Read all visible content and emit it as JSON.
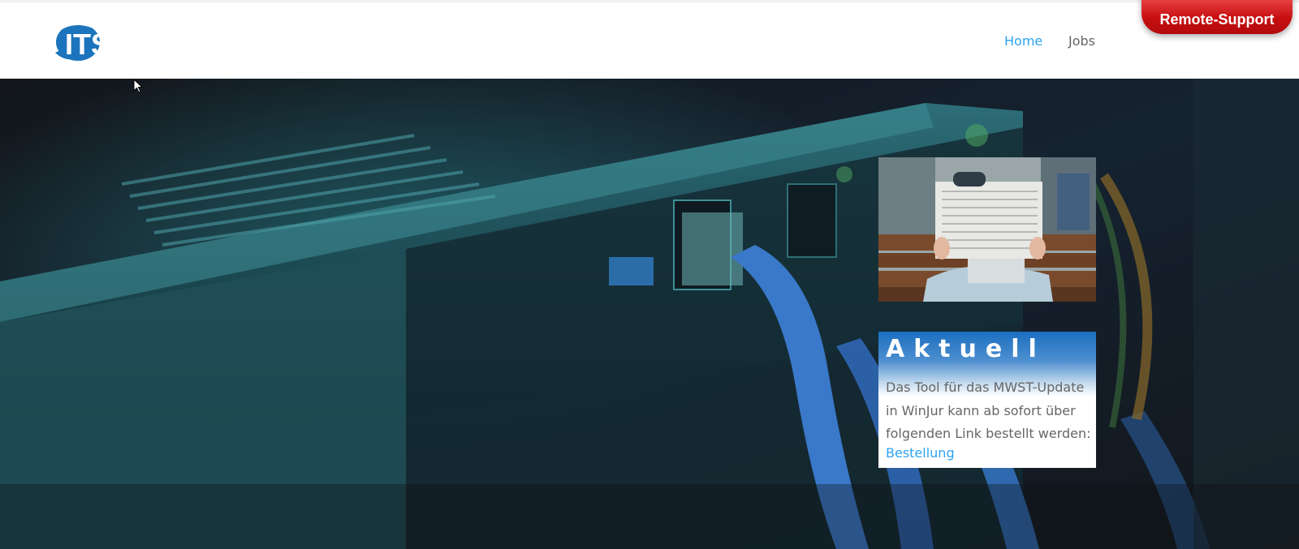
{
  "header": {
    "logo_text": "ITST",
    "nav": [
      {
        "label": "Home",
        "active": true
      },
      {
        "label": "Jobs",
        "active": false
      }
    ],
    "remote_support_label": "Remote-Support"
  },
  "hero": {
    "background_description_icon": "network-switch-photo"
  },
  "news_card": {
    "image_icon": "person-reading-newspaper-photo",
    "title": "Aktuell",
    "text": "Das Tool für das MWST-Update in WinJur kann ab sofort über folgenden Link bestellt werden:",
    "link_label": "Bestellung"
  },
  "colors": {
    "accent": "#2ea3f2",
    "nav_text": "#666666",
    "brand_blue": "#1c75bc",
    "remote_red": "#d41417"
  }
}
